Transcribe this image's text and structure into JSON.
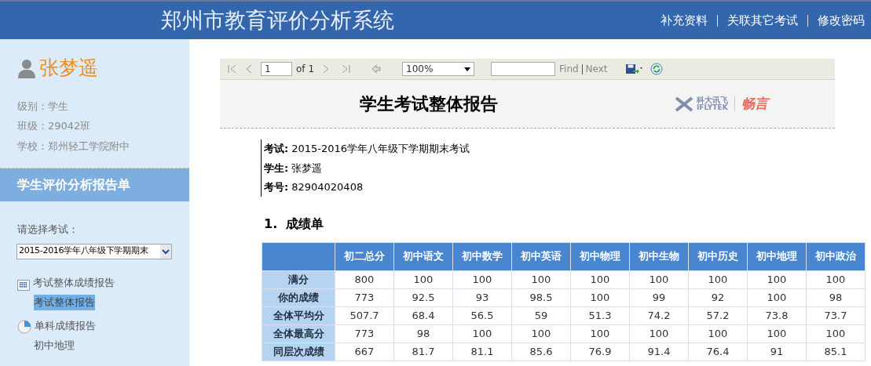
{
  "header": {
    "title": "郑州市教育评价分析系统",
    "links": [
      "补充资料",
      "关联其它考试",
      "修改密码"
    ]
  },
  "sidebar": {
    "user": "张梦遥",
    "info": [
      "级别：学生",
      "班级：29042班",
      "学校：郑州轻工学院附中"
    ],
    "section_title": "学生评价分析报告单",
    "select_label": "请选择考试：",
    "select_value": "2015-2016学年八年级下学期期末",
    "menu": [
      {
        "label": "考试整体成绩报告",
        "kind": "grid",
        "children": [
          {
            "label": "考试整体报告",
            "selected": true
          }
        ]
      },
      {
        "label": "单科成绩报告",
        "kind": "pie",
        "children": [
          {
            "label": "初中地理",
            "selected": false
          }
        ]
      }
    ]
  },
  "toolbar": {
    "page": "1",
    "of": "of 1",
    "zoom": "100%",
    "find": "Find",
    "next": "Next"
  },
  "report": {
    "title": "学生考试整体报告",
    "logo": {
      "cn": "科大讯飞",
      "en": "IFLYTEK",
      "brand": "畅言"
    },
    "meta": [
      {
        "label": "考试:",
        "value": "2015-2016学年八年级下学期期末考试"
      },
      {
        "label": "学生:",
        "value": "张梦遥"
      },
      {
        "label": "考号:",
        "value": "82904020408"
      }
    ],
    "section": "1.  成绩单",
    "table": {
      "columns": [
        "初二总分",
        "初中语文",
        "初中数学",
        "初中英语",
        "初中物理",
        "初中生物",
        "初中历史",
        "初中地理",
        "初中政治"
      ],
      "rows": [
        {
          "label": "满分",
          "cells": [
            "800",
            "100",
            "100",
            "100",
            "100",
            "100",
            "100",
            "100",
            "100"
          ]
        },
        {
          "label": "你的成绩",
          "cells": [
            "773",
            "92.5",
            "93",
            "98.5",
            "100",
            "99",
            "92",
            "100",
            "98"
          ]
        },
        {
          "label": "全体平均分",
          "cells": [
            "507.7",
            "68.4",
            "56.5",
            "59",
            "51.3",
            "74.2",
            "57.2",
            "73.8",
            "73.7"
          ]
        },
        {
          "label": "全体最高分",
          "cells": [
            "773",
            "98",
            "100",
            "100",
            "100",
            "100",
            "100",
            "100",
            "100"
          ]
        },
        {
          "label": "同层次成绩",
          "cells": [
            "667",
            "81.7",
            "81.1",
            "85.6",
            "76.9",
            "91.4",
            "76.4",
            "91",
            "85.1"
          ]
        }
      ]
    }
  }
}
